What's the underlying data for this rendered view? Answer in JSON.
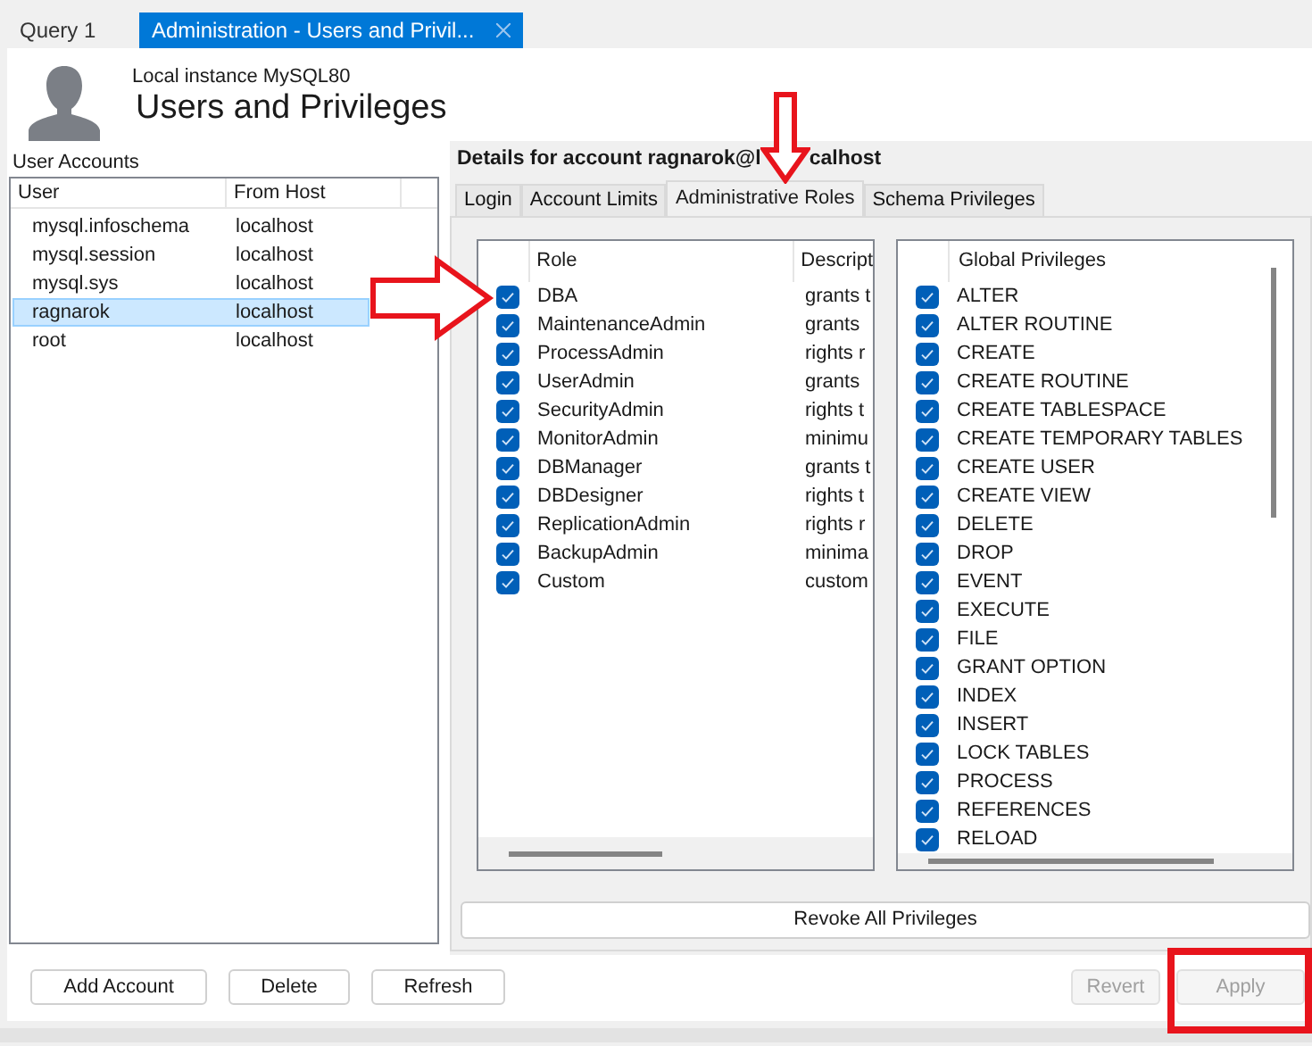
{
  "tabs": [
    {
      "label": "Query 1",
      "selected": false,
      "closable": false
    },
    {
      "label": "Administration - Users and Privil...",
      "selected": true,
      "closable": true
    }
  ],
  "header": {
    "subtitle": "Local instance MySQL80",
    "title": "Users and Privileges"
  },
  "accounts": {
    "heading": "User Accounts",
    "columns": [
      "User",
      "From Host"
    ],
    "rows": [
      {
        "user": "mysql.infoschema",
        "host": "localhost",
        "selected": false
      },
      {
        "user": "mysql.session",
        "host": "localhost",
        "selected": false
      },
      {
        "user": "mysql.sys",
        "host": "localhost",
        "selected": false
      },
      {
        "user": "ragnarok",
        "host": "localhost",
        "selected": true
      },
      {
        "user": "root",
        "host": "localhost",
        "selected": false
      }
    ]
  },
  "details": {
    "heading": "Details for account ragnarok@l",
    "heading_end": "calhost",
    "tabs": [
      {
        "label": "Login",
        "selected": false
      },
      {
        "label": "Account Limits",
        "selected": false
      },
      {
        "label": "Administrative Roles",
        "selected": true
      },
      {
        "label": "Schema Privileges",
        "selected": false
      }
    ],
    "roles": {
      "columns": [
        "Role",
        "Descript"
      ],
      "rows": [
        {
          "role": "DBA",
          "description": "grants t",
          "checked": true
        },
        {
          "role": "MaintenanceAdmin",
          "description": "grants",
          "checked": true
        },
        {
          "role": "ProcessAdmin",
          "description": "rights r",
          "checked": true
        },
        {
          "role": "UserAdmin",
          "description": "grants",
          "checked": true
        },
        {
          "role": "SecurityAdmin",
          "description": "rights t",
          "checked": true
        },
        {
          "role": "MonitorAdmin",
          "description": "minimu",
          "checked": true
        },
        {
          "role": "DBManager",
          "description": "grants t",
          "checked": true
        },
        {
          "role": "DBDesigner",
          "description": "rights t",
          "checked": true
        },
        {
          "role": "ReplicationAdmin",
          "description": "rights r",
          "checked": true
        },
        {
          "role": "BackupAdmin",
          "description": "minima",
          "checked": true
        },
        {
          "role": "Custom",
          "description": "custom",
          "checked": true
        }
      ]
    },
    "privileges": {
      "column": "Global Privileges",
      "rows": [
        {
          "name": "ALTER",
          "checked": true
        },
        {
          "name": "ALTER ROUTINE",
          "checked": true
        },
        {
          "name": "CREATE",
          "checked": true
        },
        {
          "name": "CREATE ROUTINE",
          "checked": true
        },
        {
          "name": "CREATE TABLESPACE",
          "checked": true
        },
        {
          "name": "CREATE TEMPORARY TABLES",
          "checked": true
        },
        {
          "name": "CREATE USER",
          "checked": true
        },
        {
          "name": "CREATE VIEW",
          "checked": true
        },
        {
          "name": "DELETE",
          "checked": true
        },
        {
          "name": "DROP",
          "checked": true
        },
        {
          "name": "EVENT",
          "checked": true
        },
        {
          "name": "EXECUTE",
          "checked": true
        },
        {
          "name": "FILE",
          "checked": true
        },
        {
          "name": "GRANT OPTION",
          "checked": true
        },
        {
          "name": "INDEX",
          "checked": true
        },
        {
          "name": "INSERT",
          "checked": true
        },
        {
          "name": "LOCK TABLES",
          "checked": true
        },
        {
          "name": "PROCESS",
          "checked": true
        },
        {
          "name": "REFERENCES",
          "checked": true
        },
        {
          "name": "RELOAD",
          "checked": true
        }
      ]
    },
    "revoke_button": "Revoke All Privileges"
  },
  "left_buttons": [
    "Add Account",
    "Delete",
    "Refresh"
  ],
  "right_buttons": [
    {
      "label": "Revert",
      "disabled": true
    },
    {
      "label": "Apply",
      "disabled": true
    }
  ],
  "annotations": [
    {
      "kind": "arrow-down"
    },
    {
      "kind": "arrow-right"
    },
    {
      "kind": "highlight-box"
    }
  ]
}
